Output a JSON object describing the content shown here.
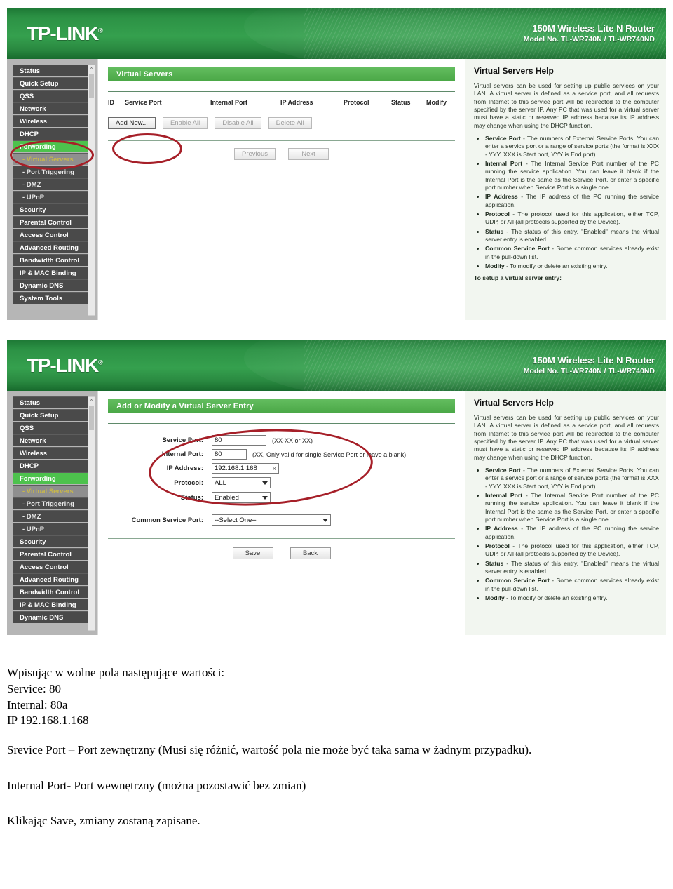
{
  "router": {
    "brand": "TP-LINK",
    "brand_mark": "®",
    "model_title": "150M Wireless Lite N Router",
    "model_sub": "Model No. TL-WR740N / TL-WR740ND",
    "accent_green": "#4dc24d",
    "header_green": "#2c9245",
    "annotation_red": "#a61f28",
    "menu": [
      {
        "label": "Status",
        "type": "top"
      },
      {
        "label": "Quick Setup",
        "type": "top"
      },
      {
        "label": "QSS",
        "type": "top"
      },
      {
        "label": "Network",
        "type": "top"
      },
      {
        "label": "Wireless",
        "type": "top"
      },
      {
        "label": "DHCP",
        "type": "top"
      },
      {
        "label": "Forwarding",
        "type": "active"
      },
      {
        "label": "- Virtual Servers",
        "type": "sub-active"
      },
      {
        "label": "- Port Triggering",
        "type": "sub"
      },
      {
        "label": "- DMZ",
        "type": "sub"
      },
      {
        "label": "- UPnP",
        "type": "sub"
      },
      {
        "label": "Security",
        "type": "top"
      },
      {
        "label": "Parental Control",
        "type": "top"
      },
      {
        "label": "Access Control",
        "type": "top"
      },
      {
        "label": "Advanced Routing",
        "type": "top"
      },
      {
        "label": "Bandwidth Control",
        "type": "top"
      },
      {
        "label": "IP & MAC Binding",
        "type": "top"
      },
      {
        "label": "Dynamic DNS",
        "type": "top"
      },
      {
        "label": "System Tools",
        "type": "top"
      }
    ]
  },
  "shot1": {
    "section_title": "Virtual Servers",
    "columns": [
      "ID",
      "Service Port",
      "Internal Port",
      "IP Address",
      "Protocol",
      "Status",
      "Modify"
    ],
    "buttons": {
      "add_new": "Add New...",
      "enable_all": "Enable All",
      "disable_all": "Disable All",
      "delete_all": "Delete All",
      "previous": "Previous",
      "next": "Next"
    }
  },
  "shot2": {
    "section_title": "Add or Modify a Virtual Server Entry",
    "fields": {
      "service_port_label": "Service Port:",
      "service_port_value": "80",
      "service_port_hint": "(XX-XX or XX)",
      "internal_port_label": "Internal Port:",
      "internal_port_value": "80",
      "internal_port_hint": "(XX, Only valid for single Service Port or leave a blank)",
      "ip_address_label": "IP Address:",
      "ip_address_value": "192.168.1.168",
      "ip_clear_icon": "×",
      "protocol_label": "Protocol:",
      "protocol_value": "ALL",
      "status_label": "Status:",
      "status_value": "Enabled",
      "common_service_port_label": "Common Service Port:",
      "common_service_port_value": "--Select One--"
    },
    "buttons": {
      "save": "Save",
      "back": "Back"
    }
  },
  "help": {
    "title": "Virtual Servers Help",
    "intro": "Virtual servers can be used for setting up public services on your LAN. A virtual server is defined as a service port, and all requests from Internet to this service port will be redirected to the computer specified by the server IP. Any PC that was used for a virtual server must have a static or reserved IP address because its IP address may change when using the DHCP function.",
    "items": [
      {
        "term": "Service Port",
        "text": " - The numbers of External Service Ports. You can enter a service port or a range of service ports (the format is XXX - YYY, XXX is Start port, YYY is End port)."
      },
      {
        "term": "Internal Port",
        "text": " - The Internal Service Port number of the PC running the service application. You can leave it blank if the Internal Port is the same as the Service Port, or enter a specific port number when Service Port is a single one."
      },
      {
        "term": "IP Address",
        "text": " - The IP address of the PC running the service application."
      },
      {
        "term": "Protocol",
        "text": " - The protocol used for this application, either TCP, UDP, or All (all protocols supported by the Device)."
      },
      {
        "term": "Status",
        "text": " - The status of this entry, \"Enabled\" means the virtual server entry is enabled."
      },
      {
        "term": "Common Service Port",
        "text": " - Some common services already exist in the pull-down list."
      },
      {
        "term": "Modify",
        "text": " - To modify or delete an existing entry."
      }
    ],
    "closing": "To setup a virtual server entry:"
  },
  "notes": {
    "block1_line1": "Wpisując w wolne pola następujące wartości:",
    "block1_line2": "Service: 80",
    "block1_line3": "Internal: 80a",
    "block1_line4": "IP 192.168.1.168",
    "para1": "Srevice Port – Port zewnętrzny (Musi się różnić, wartość pola nie może być taka sama w żadnym przypadku).",
    "para2": "Internal Port- Port wewnętrzny (można pozostawić bez zmian)",
    "para3": "Klikając Save, zmiany zostaną zapisane."
  }
}
